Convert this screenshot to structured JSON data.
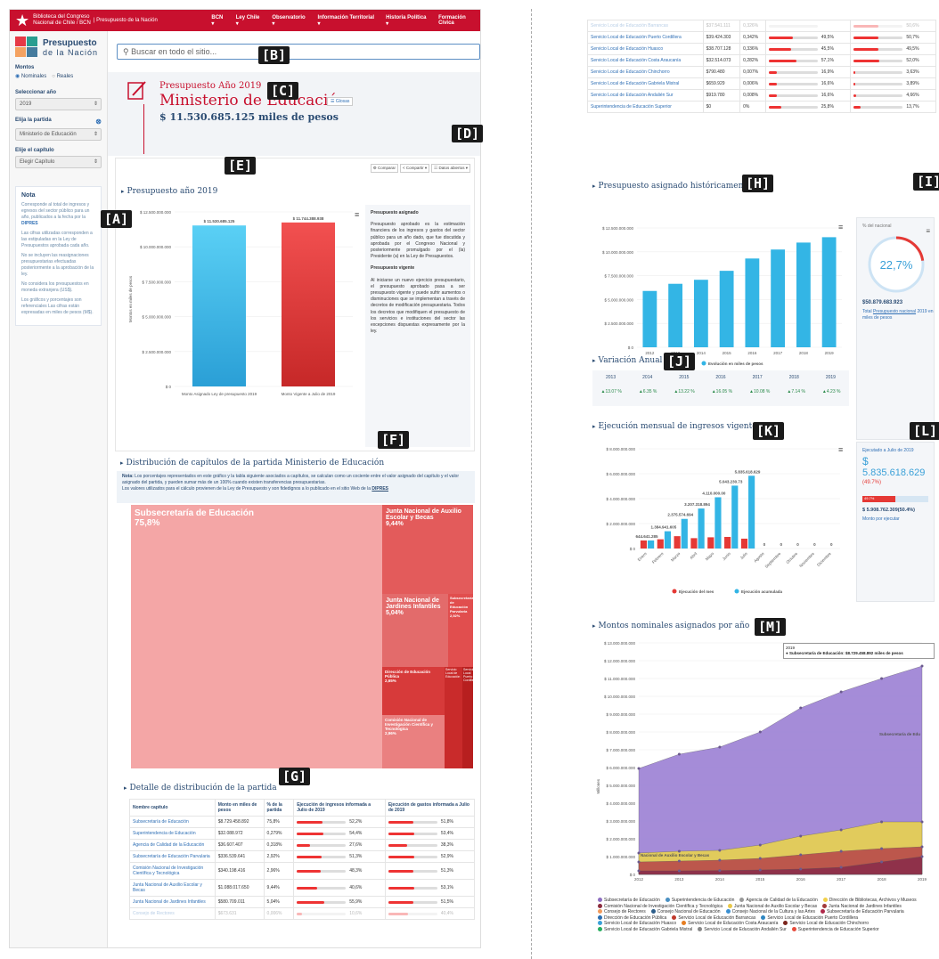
{
  "topbar": {
    "brand_line1": "Biblioteca del Congreso",
    "brand_line2": "Nacional de Chile / BCN",
    "section": "| Presupuesto de la Nación",
    "nav": [
      "BCN ▾",
      "Ley Chile ▾",
      "Observatorio ▾",
      "Información Territorial ▾",
      "Historia Política ▾",
      "Formación Cívica"
    ]
  },
  "logo": {
    "line1": "Presupuesto",
    "line2": "de la Nación"
  },
  "sidebar": {
    "montos_label": "Montos",
    "radio_nominales": "Nominales",
    "radio_reales": "Reales",
    "anio_label": "Seleccionar año",
    "anio_value": "2019",
    "partida_label": "Elija la partida",
    "partida_value": "Ministerio de Educación",
    "capitulo_label": "Elije el capítulo",
    "capitulo_value": "Elegir Capítulo",
    "nota_title": "Nota",
    "nota_p1": "Corresponde al total de ingresos y egresos del sector público para un año, publicados a la fecha por la",
    "nota_p1_link": "DIPRES",
    "nota_p2": "Las cifras utilizadas corresponden a las estipuladas en la Ley de Presupuestos aprobada cada año.",
    "nota_p3": "No se incluyen las reasignaciones presupuestarias efectuadas posteriormente a la aprobación de la ley.",
    "nota_p4": "No considera los presupuestos en moneda extranjera (US$).",
    "nota_p5": "Los gráficos y porcentajes son referenciales Las cifras están expresadas en miles de pesos (M$)."
  },
  "search": {
    "placeholder": "Buscar en todo el sitio..."
  },
  "header": {
    "kicker": "Presupuesto Año 2019",
    "title": "Ministerio de Educación",
    "glosa": "Glosas",
    "amount": "$ 11.530.685.125 miles de pesos"
  },
  "actions": {
    "comparar": "Comparar",
    "compartir": "Compartir ▾",
    "datos": "Datos abiertos ▾"
  },
  "sections": {
    "presupuesto": "Presupuesto año 2019",
    "distribucion": "Distribución de capítulos de la partida Ministerio de Educación",
    "detalle": "Detalle de distribución de la partida",
    "historico": "Presupuesto asignado históricamente",
    "variacion": "Variación Anual",
    "ejecucion": "Ejecución mensual de ingresos vigentes",
    "montos": "Montos nominales asignados por año"
  },
  "presupuesto_side": {
    "h1": "Presupuesto asignado",
    "p1": "Presupuesto aprobado es la estimación financiera de los ingresos y gastos del sector público para un año dado, que fue discutida y aprobada por el Congreso Nacional y posteriormente promulgado por el (la) Presidente (a) en la Ley de Presupuestos.",
    "h2": "Presupuesto vigente",
    "p2": "Al iniciarse un nuevo ejercicio presupuestario, el presupuesto aprobado pasa a ser presupuesto vigente y puede sufrir aumentos o disminuciones que se implementan a través de decretos de modificación presupuestaria. Todos los decretos que modifiquen el presupuesto de los servicios e instituciones del sector las excepciones dispuestas expresamente por la ley."
  },
  "distribucion_note": {
    "bold": "Nota:",
    "text": "Los porcentajes representados en este gráfico y la tabla siguiente asociados a capítulos, se calculan como un cociente entre el valor asignado del capítulo y el valor asignado del partida, y pueden sumar más de un 100% cuando existen transferencias presupuestarias.",
    "text2": "Los valores utilizados para el cálculo provienen de la Ley de Presupuesto y son fidedignos a lo publicado en el sitio Web de la",
    "link": "DIPRES"
  },
  "treemap": [
    {
      "label": "Subsecretaría de Educación",
      "pct": "75,8%"
    },
    {
      "label": "Junta Nacional de Auxilio Escolar y Becas",
      "pct": "9,44%"
    },
    {
      "label": "Junta Nacional de Jardines Infantiles",
      "pct": "5,04%"
    },
    {
      "label": "Subsecretaría de Educación Parvularia",
      "pct": "2,92%"
    },
    {
      "label": "Dirección de Educación Pública",
      "pct": "2,65%"
    },
    {
      "label": "Comisión Nacional de Investigación Científica y Tecnológica",
      "pct": "2,96%"
    },
    {
      "label": "Servicio Local de Educación",
      "pct": ""
    },
    {
      "label": "Servicio Local Puerto Cordillera",
      "pct": ""
    }
  ],
  "table": {
    "headers": [
      "Nombre capítulo",
      "Monto en miles de pesos",
      "% de la partida",
      "Ejecución de ingresos informada a Julio de 2019",
      "Ejecución de gastos informada a Julio de 2019"
    ],
    "rows": [
      [
        "Subsecretaría de Educación",
        "$8.729.458.892",
        "75,8%",
        "52,2%",
        "51,8%"
      ],
      [
        "Superintendencia de Educación",
        "$32.088.972",
        "0,279%",
        "54,4%",
        "53,4%"
      ],
      [
        "Agencia de Calidad de la Educación",
        "$36.607.407",
        "0,318%",
        "27,6%",
        "38,3%"
      ],
      [
        "Subsecretaría de Educación Parvularia",
        "$336.539.641",
        "2,92%",
        "51,3%",
        "52,9%"
      ],
      [
        "Comisión Nacional de Investigación Científica y Tecnológica",
        "$340.198.416",
        "2,96%",
        "48,3%",
        "51,3%"
      ],
      [
        "Junta Nacional de Auxilio Escolar y Becas",
        "$1.088.017.650",
        "9,44%",
        "40,6%",
        "53,1%"
      ],
      [
        "Junta Nacional de Jardines Infantiles",
        "$580.709.011",
        "5,04%",
        "55,9%",
        "51,5%"
      ],
      [
        "Consejo de Rectores",
        "$673.631",
        "0,006%",
        "10,6%",
        "40,4%"
      ]
    ],
    "rows_right": [
      [
        "Servicio Local de Educación Barrancas",
        "$37.541.111",
        "0,326%",
        "",
        "50,6%"
      ],
      [
        "Servicio Local de Educación Puerto Cordillera",
        "$39.424.303",
        "0,342%",
        "49,5%",
        "50,7%"
      ],
      [
        "Servicio Local de Educación Huasco",
        "$38.707.128",
        "0,336%",
        "45,5%",
        "49,5%"
      ],
      [
        "Servicio Local de Educación Costa Araucanía",
        "$32.514.073",
        "0,282%",
        "57,1%",
        "52,0%"
      ],
      [
        "Servicio Local de Educación Chinchorro",
        "$790.480",
        "0,007%",
        "16,9%",
        "3,63%"
      ],
      [
        "Servicio Local de Educación Gabriela Mistral",
        "$659.929",
        "0,006%",
        "16,6%",
        "3,89%"
      ],
      [
        "Servicio Local de Educación Andalién Sur",
        "$919.780",
        "0,008%",
        "16,6%",
        "4,66%"
      ],
      [
        "Superintendencia de Educación Superior",
        "$0",
        "0%",
        "25,8%",
        "13,7%"
      ]
    ]
  },
  "nacional_card": {
    "label": "% del nacional",
    "pct": "22,7%",
    "amount": "$50.879.683.923",
    "desc_pre": "Total",
    "desc_link": "Presupuesto nacional",
    "desc_post": "2019 en miles de pesos"
  },
  "ejecutado_card": {
    "label": "Ejecutado a Julio de 2019",
    "symbol": "$",
    "amount": "5.835.618.629",
    "pct": "(49.7%)",
    "bar_label": "49.7%",
    "total": "$ 5.908.762.309(50.4%)",
    "sub": "Monto por ejecutar"
  },
  "variacion": {
    "years": [
      "2013",
      "2014",
      "2015",
      "2016",
      "2017",
      "2018",
      "2019"
    ],
    "values": [
      "▲13.07 %",
      "▲6.35 %",
      "▲13.22 %",
      "▲16.05 %",
      "▲10.08 %",
      "▲7.14 %",
      "▲4.23 %"
    ]
  },
  "tooltip": {
    "year": "2019",
    "text": "● Subsecretaría de Educación: $8.729.458.892 miles de pesos"
  },
  "area_labels": {
    "top": "Subsecretaría de Edu",
    "bottom": "Nacional de Auxilio Escolar y Becas"
  },
  "area_legend": [
    {
      "name": "Subsecretaría de Educación",
      "color": "#8e6fc1"
    },
    {
      "name": "Superintendencia de Educación",
      "color": "#4a90c2"
    },
    {
      "name": "Agencia de Calidad de la Educación",
      "color": "#999999"
    },
    {
      "name": "Dirección de Bibliotecas, Archivos y Museos",
      "color": "#f2d04a"
    },
    {
      "name": "Comisión Nacional de Investigación Científica y Tecnológica",
      "color": "#8b2c3f"
    },
    {
      "name": "Junta Nacional de Auxilio Escolar y Becas",
      "color": "#e8c84a"
    },
    {
      "name": "Junta Nacional de Jardines Infantiles",
      "color": "#a23b3b"
    },
    {
      "name": "Consejo de Rectores",
      "color": "#f19a5c"
    },
    {
      "name": "Consejo Nacional de Educación",
      "color": "#2b5d8a"
    },
    {
      "name": "Consejo Nacional de la Cultura y las Artes",
      "color": "#3b8fd1"
    },
    {
      "name": "Subsecretaría de Educación Parvularia",
      "color": "#b02a4b"
    },
    {
      "name": "Dirección de Educación Pública",
      "color": "#2a6db0"
    },
    {
      "name": "Servicio Local de Educación Barrancas",
      "color": "#c0392b"
    },
    {
      "name": "Servicio Local de Educación Puerto Cordillera",
      "color": "#2e86c1"
    },
    {
      "name": "Servicio Local de Educación Huasco",
      "color": "#3aa0d8"
    },
    {
      "name": "Servicio Local de Educación Costa Araucanía",
      "color": "#e67e22"
    },
    {
      "name": "Servicio Local de Educación Chinchorro",
      "color": "#7b241c"
    },
    {
      "name": "Servicio Local de Educación Gabriela Mistral",
      "color": "#27ae60"
    },
    {
      "name": "Servicio Local de Educación Andalién Sur",
      "color": "#888888"
    },
    {
      "name": "Superintendencia de Educación Superior",
      "color": "#e74c3c"
    }
  ],
  "chart_data": [
    {
      "type": "bar",
      "title": "Presupuesto año 2019",
      "categories": [
        "Monto Asignado Ley de presupuesto 2019",
        "Monto Vigente a Julio de 2019"
      ],
      "values": [
        11530685125,
        11744388938
      ],
      "data_labels": [
        "$ 11.530.685.125",
        "$ 11.744.388.938"
      ],
      "ylabel": "Montos en miles de pesos",
      "ylim": [
        0,
        12500000000
      ],
      "yticks": [
        "$ 0",
        "$ 2.500.000.000",
        "$ 5.000.000.000",
        "$ 7.500.000.000",
        "$ 10.000.000.000",
        "$ 12.500.000.000"
      ]
    },
    {
      "type": "bar",
      "title": "Presupuesto asignado históricamente",
      "categories": [
        "2012",
        "2013",
        "2014",
        "2015",
        "2016",
        "2017",
        "2018",
        "2019"
      ],
      "values": [
        5900000000,
        6650000000,
        7070000000,
        8010000000,
        9300000000,
        10240000000,
        10970000000,
        11530685125
      ],
      "legend": "Evolución en miles de pesos",
      "ylim": [
        0,
        12500000000
      ],
      "yticks": [
        "$ 0",
        "$ 2.500.000.000",
        "$ 5.000.000.000",
        "$ 7.500.000.000",
        "$ 10.000.000.000",
        "$ 12.500.000.000"
      ]
    },
    {
      "type": "bar",
      "title": "Ejecución mensual de ingresos vigentes",
      "categories": [
        "Enero",
        "Febrero",
        "Marzo",
        "Abril",
        "Mayo",
        "Junio",
        "Julio",
        "Agosto",
        "Septiembre",
        "Octubre",
        "Noviembre",
        "Diciembre"
      ],
      "series": [
        {
          "name": "Ejecución del mes",
          "values": [
            644641285,
            740000000,
            990000000,
            830000000,
            900000000,
            930000000,
            790000000,
            0,
            0,
            0,
            0,
            0
          ]
        },
        {
          "name": "Ejecución acumulada",
          "values": [
            644641285,
            1384941605,
            2375574694,
            3207318894,
            4110000000,
            5043230000,
            5835618629,
            0,
            0,
            0,
            0,
            0
          ]
        }
      ],
      "data_labels": [
        "644.641.285",
        "1.384.941.605",
        "2.375.574.694",
        "3.207.318.894",
        "4.110.000.00",
        "5.043.230.73",
        "5.835.618.629",
        "0",
        "0",
        "0",
        "0",
        "0"
      ],
      "ylim": [
        0,
        8000000000
      ],
      "yticks": [
        "$ 0",
        "$ 2.000.000.000",
        "$ 4.000.000.000",
        "$ 6.000.000.000",
        "$ 8.000.000.000"
      ]
    },
    {
      "type": "area",
      "title": "Montos nominales asignados por año",
      "x": [
        "2012",
        "2013",
        "2014",
        "2015",
        "2016",
        "2017",
        "2018",
        "2019"
      ],
      "ylabel": "Millones",
      "ylim": [
        0,
        13000000000
      ],
      "yticks": [
        "$ 0",
        "$ 1.000.000.000",
        "$ 2.000.000.000",
        "$ 3.000.000.000",
        "$ 4.000.000.000",
        "$ 5.000.000.000",
        "$ 6.000.000.000",
        "$ 7.000.000.000",
        "$ 8.000.000.000",
        "$ 9.000.000.000",
        "$ 10.000.000.000",
        "$ 11.000.000.000",
        "$ 12.000.000.000",
        "$ 13.000.000.000"
      ],
      "series": [
        {
          "name": "Subsecretaría de Educación",
          "values": [
            5950000000,
            6750000000,
            7150000000,
            8000000000,
            9350000000,
            10250000000,
            11000000000,
            11700000000
          ]
        },
        {
          "name": "Junta Nacional de Auxilio Escolar y Becas",
          "values": [
            1200000000,
            1300000000,
            1350000000,
            1650000000,
            2150000000,
            2500000000,
            2950000000,
            2950000000
          ]
        },
        {
          "name": "Junta Nacional de Jardines Infantiles",
          "values": [
            700000000,
            750000000,
            800000000,
            900000000,
            1100000000,
            1300000000,
            1450000000,
            1550000000
          ]
        },
        {
          "name": "Subsecretaría de Educación Parvularia",
          "values": [
            200000000,
            200000000,
            220000000,
            250000000,
            300000000,
            400000000,
            700000000,
            1000000000
          ]
        }
      ]
    }
  ]
}
